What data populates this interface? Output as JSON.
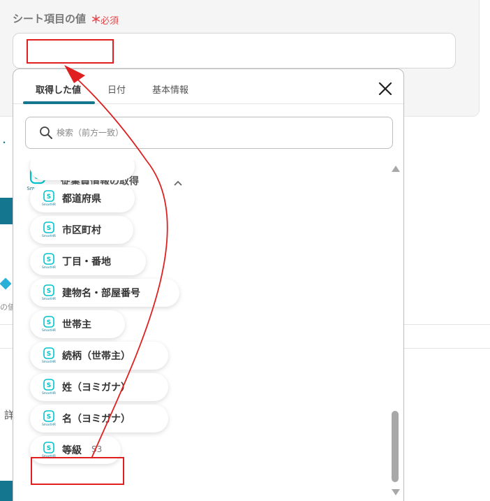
{
  "field": {
    "label": "シート項目の値",
    "required_mark": "＊",
    "required_text": "必須",
    "value": ""
  },
  "background": {
    "fragment_1": "の値",
    "fragment_2": "詳",
    "fragment_dot": "・"
  },
  "tabs": [
    {
      "label": "取得した値",
      "active": true
    },
    {
      "label": "日付",
      "active": false
    },
    {
      "label": "基本情報",
      "active": false
    }
  ],
  "search": {
    "placeholder": "検索（前方一致）",
    "value": ""
  },
  "group": {
    "logo_text": "SmartHR",
    "title": "従業員情報の取得",
    "expanded": true
  },
  "items": [
    {
      "label": "都道府県",
      "value": ""
    },
    {
      "label": "市区町村",
      "value": ""
    },
    {
      "label": "丁目・番地",
      "value": ""
    },
    {
      "label": "建物名・部屋番号",
      "value": ""
    },
    {
      "label": "世帯主",
      "value": ""
    },
    {
      "label": "続柄（世帯主）",
      "value": ""
    },
    {
      "label": "姓（ヨミガナ）",
      "value": ""
    },
    {
      "label": "名（ヨミガナ）",
      "value": ""
    },
    {
      "label": "等級",
      "value": "S3"
    }
  ],
  "icons": {
    "logo_mark": "S",
    "logo_small_text": "SmartHR",
    "search": "search-icon",
    "close": "close-icon",
    "chevron": "chevron-up-icon"
  },
  "colors": {
    "accent": "#157690",
    "smarthr": "#00c4cc",
    "annotation": "#e02020",
    "required": "#e5484d"
  }
}
